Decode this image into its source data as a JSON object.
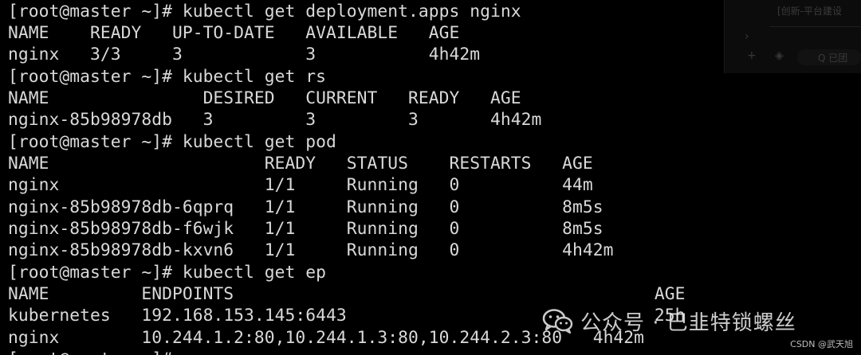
{
  "terminal": {
    "lines": [
      "[root@master ~]# kubectl get deployment.apps nginx",
      "NAME    READY   UP-TO-DATE   AVAILABLE   AGE",
      "nginx   3/3     3            3           4h42m",
      "[root@master ~]# kubectl get rs",
      "NAME               DESIRED   CURRENT   READY   AGE",
      "nginx-85b98978db   3         3         3       4h42m",
      "[root@master ~]# kubectl get pod",
      "NAME                     READY   STATUS    RESTARTS   AGE",
      "nginx                    1/1     Running   0          44m",
      "nginx-85b98978db-6qprq   1/1     Running   0          8m5s",
      "nginx-85b98978db-f6wjk   1/1     Running   0          8m5s",
      "nginx-85b98978db-kxvn6   1/1     Running   0          4h42m",
      "[root@master ~]# kubectl get ep",
      "NAME         ENDPOINTS                                         AGE",
      "kubernetes   192.168.153.145:6443                              25h",
      "nginx        10.244.1.2:80,10.244.1.3:80,10.244.2.3:80   4h42m",
      "[root@master ~]# "
    ]
  },
  "overlay_panel": {
    "title": "[创新-平台建设",
    "search_text": "Q 已团"
  },
  "watermark": {
    "text": "公众号 · 巴韭特锁螺丝"
  },
  "credit": {
    "text": "CSDN @武天旭"
  }
}
